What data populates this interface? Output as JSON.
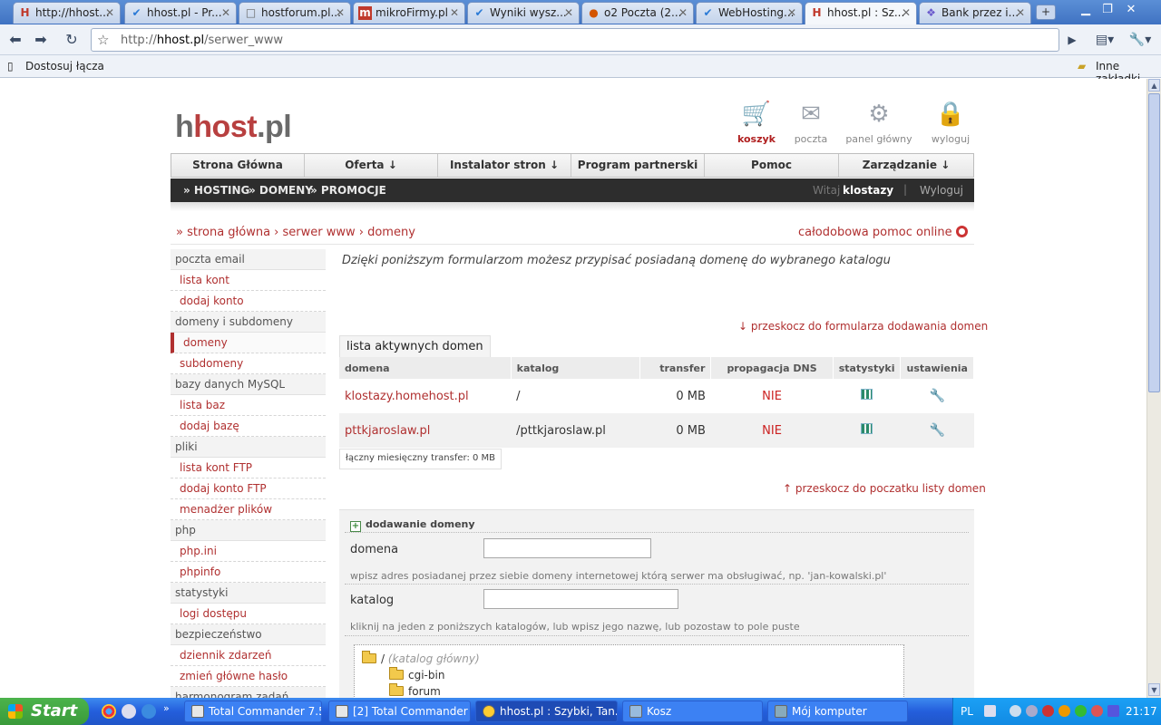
{
  "browser": {
    "tabs": [
      {
        "label": "http://hhost...",
        "icon": "H",
        "color": "#c0392b"
      },
      {
        "label": "hhost.pl - Pr...",
        "icon": "✔",
        "color": "#2a7ad6"
      },
      {
        "label": "hostforum.pl...",
        "icon": "□",
        "color": "#666"
      },
      {
        "label": "mikroFirmy.pl",
        "icon": "m",
        "color": "#c0392b"
      },
      {
        "label": "Wyniki wysz...",
        "icon": "✔",
        "color": "#2a7ad6"
      },
      {
        "label": "o2 Poczta (2...",
        "icon": "●",
        "color": "#d35400"
      },
      {
        "label": "WebHosting...",
        "icon": "✔",
        "color": "#2a7ad6"
      },
      {
        "label": "hhost.pl : Sz...",
        "icon": "H",
        "color": "#c0392b"
      },
      {
        "label": "Bank przez i...",
        "icon": "❖",
        "color": "#6a5acd"
      }
    ],
    "url_prefix": "http://",
    "url_host": "hhost.pl",
    "url_path": "/serwer_www",
    "bookmarks": {
      "customize": "Dostosuj łącza",
      "other": "Inne zakładki"
    }
  },
  "site": {
    "logo_h": "h",
    "logo_host": "host",
    "logo_pl": ".pl",
    "top_icons": [
      {
        "label": "koszyk",
        "icon": "cart-icon"
      },
      {
        "label": "poczta",
        "icon": "mail-icon"
      },
      {
        "label": "panel główny",
        "icon": "gears-icon"
      },
      {
        "label": "wyloguj",
        "icon": "lock-icon"
      }
    ],
    "main_nav": [
      "Strona Główna",
      "Oferta ↓",
      "Instalator stron ↓",
      "Program partnerski",
      "Pomoc",
      "Zarządzanie ↓"
    ],
    "sub_nav": [
      "» HOSTING",
      "» DOMENY",
      "» PROMOCJE"
    ],
    "welcome": "Witaj",
    "username": "klostazy",
    "logout": "Wyloguj",
    "breadcrumb": "» strona główna › serwer www › domeny",
    "help": "całodobowa pomoc online"
  },
  "sidebar": [
    {
      "type": "cat",
      "label": "poczta email"
    },
    {
      "type": "item",
      "label": "lista kont"
    },
    {
      "type": "item",
      "label": "dodaj konto"
    },
    {
      "type": "cat",
      "label": "domeny i subdomeny"
    },
    {
      "type": "item",
      "label": "domeny",
      "current": true
    },
    {
      "type": "item",
      "label": "subdomeny"
    },
    {
      "type": "cat",
      "label": "bazy danych MySQL"
    },
    {
      "type": "item",
      "label": "lista baz"
    },
    {
      "type": "item",
      "label": "dodaj bazę"
    },
    {
      "type": "cat",
      "label": "pliki"
    },
    {
      "type": "item",
      "label": "lista kont FTP"
    },
    {
      "type": "item",
      "label": "dodaj konto FTP"
    },
    {
      "type": "item",
      "label": "menadżer plików"
    },
    {
      "type": "cat",
      "label": "php"
    },
    {
      "type": "item",
      "label": "php.ini"
    },
    {
      "type": "item",
      "label": "phpinfo"
    },
    {
      "type": "cat",
      "label": "statystyki"
    },
    {
      "type": "item",
      "label": "logi dostępu"
    },
    {
      "type": "cat",
      "label": "bezpieczeństwo"
    },
    {
      "type": "item",
      "label": "dziennik zdarzeń"
    },
    {
      "type": "item",
      "label": "zmień główne hasło"
    },
    {
      "type": "cat",
      "label": "harmonogram zadań"
    }
  ],
  "content": {
    "intro": "Dzięki poniższym formularzom możesz przypisać posiadaną domenę do wybranego katalogu",
    "skip_to_form": "↓ przeskocz do formularza dodawania domen",
    "tab_label": "lista aktywnych domen",
    "columns": [
      "domena",
      "katalog",
      "transfer",
      "propagacja DNS",
      "statystyki",
      "ustawienia"
    ],
    "rows": [
      {
        "domain": "klostazy.homehost.pl",
        "dir": "/",
        "transfer": "0 MB",
        "dns": "NIE"
      },
      {
        "domain": "pttkjaroslaw.pl",
        "dir": "/pttkjaroslaw.pl",
        "transfer": "0 MB",
        "dns": "NIE"
      }
    ],
    "total": "łączny miesięczny transfer: 0 MB",
    "skip_to_top": "↑ przeskocz do poczatku listy domen",
    "form": {
      "title": "dodawanie domeny",
      "domain_label": "domena",
      "domain_value": "",
      "domain_hint": "wpisz adres posiadanej przez siebie domeny internetowej którą serwer ma obsługiwać, np. 'jan-kowalski.pl'",
      "dir_label": "katalog",
      "dir_value": "",
      "dir_hint": "kliknij na jeden z poniższych katalogów, lub wpisz jego nazwę, lub pozostaw to pole puste",
      "tree_root": "/",
      "tree_root_note": "(katalog główny)",
      "tree_items": [
        "cgi-bin",
        "forum"
      ]
    }
  },
  "taskbar": {
    "start": "Start",
    "tasks": [
      "Total Commander 7.5...",
      "[2] Total Commander ...",
      "hhost.pl : Szybki, Tan...",
      "Kosz",
      "Mój komputer"
    ],
    "lang": "PL",
    "clock": "21:17"
  }
}
